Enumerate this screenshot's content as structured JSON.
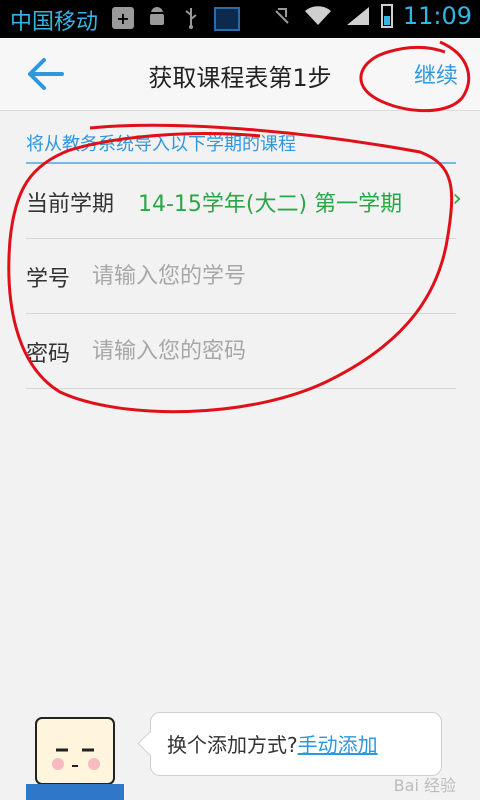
{
  "status_bar": {
    "carrier": "中国移动",
    "time": "11:09",
    "icons": [
      "add-icon",
      "android-icon",
      "usb-icon",
      "gallery-icon",
      "mute-icon",
      "wifi-icon",
      "signal-icon",
      "battery-icon"
    ]
  },
  "app_bar": {
    "title": "获取课程表第1步",
    "continue_label": "继续",
    "back_icon": "arrow-left-icon"
  },
  "notice": "将从教务系统导入以下学期的课程",
  "form": {
    "term_label": "当前学期",
    "term_value": "14-15学年(大二) 第一学期",
    "student_id_label": "学号",
    "student_id_placeholder": "请输入您的学号",
    "password_label": "密码",
    "password_placeholder": "请输入您的密码"
  },
  "bottom_bubble": {
    "prompt": "换个添加方式?",
    "link": "手动添加"
  },
  "watermark": "Bai 经验",
  "colors": {
    "accent": "#2f97e0",
    "term_value": "#28a745",
    "annotation": "#e0101a"
  }
}
